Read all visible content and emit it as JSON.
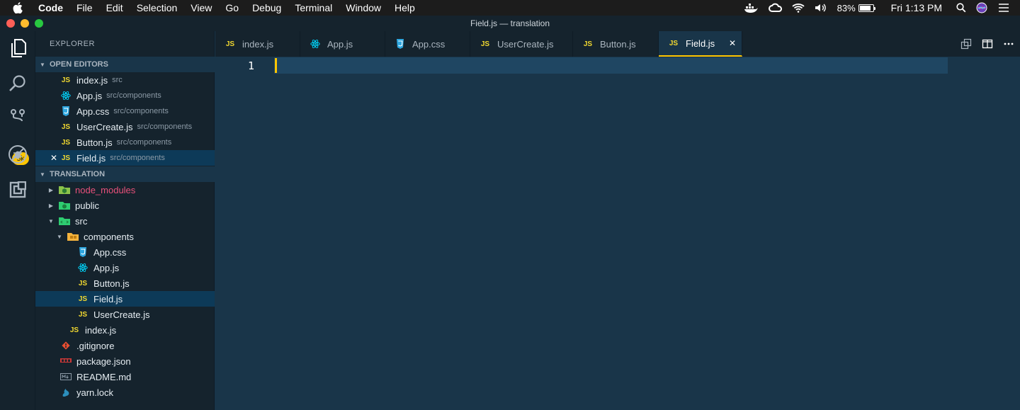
{
  "menubar": {
    "app": "Code",
    "items": [
      "File",
      "Edit",
      "Selection",
      "View",
      "Go",
      "Debug",
      "Terminal",
      "Window",
      "Help"
    ],
    "battery_percent": "83%",
    "battery_level": 0.83,
    "clock": "Fri 1:13 PM"
  },
  "window": {
    "title": "Field.js — translation"
  },
  "activity": {
    "scm_badge": "5k"
  },
  "sidebar": {
    "title": "EXPLORER",
    "open_editors_label": "OPEN EDITORS",
    "open_editors": [
      {
        "name": "index.js",
        "path": "src",
        "type": "js"
      },
      {
        "name": "App.js",
        "path": "src/components",
        "type": "react"
      },
      {
        "name": "App.css",
        "path": "src/components",
        "type": "css"
      },
      {
        "name": "UserCreate.js",
        "path": "src/components",
        "type": "js"
      },
      {
        "name": "Button.js",
        "path": "src/components",
        "type": "js"
      },
      {
        "name": "Field.js",
        "path": "src/components",
        "type": "js"
      }
    ],
    "project_label": "TRANSLATION",
    "tree": [
      {
        "name": "node_modules",
        "type": "folder-node"
      },
      {
        "name": "public",
        "type": "folder-public"
      },
      {
        "name": "src",
        "type": "folder-src"
      },
      {
        "name": "components",
        "type": "folder-components"
      },
      {
        "name": "App.css",
        "type": "css"
      },
      {
        "name": "App.js",
        "type": "react"
      },
      {
        "name": "Button.js",
        "type": "js"
      },
      {
        "name": "Field.js",
        "type": "js"
      },
      {
        "name": "UserCreate.js",
        "type": "js"
      },
      {
        "name": "index.js",
        "type": "js"
      },
      {
        "name": ".gitignore",
        "type": "git"
      },
      {
        "name": "package.json",
        "type": "npm"
      },
      {
        "name": "README.md",
        "type": "md"
      },
      {
        "name": "yarn.lock",
        "type": "yarn"
      }
    ]
  },
  "tabs": [
    {
      "label": "index.js",
      "type": "js"
    },
    {
      "label": "App.js",
      "type": "react"
    },
    {
      "label": "App.css",
      "type": "css"
    },
    {
      "label": "UserCreate.js",
      "type": "js"
    },
    {
      "label": "Button.js",
      "type": "js"
    },
    {
      "label": "Field.js",
      "type": "js"
    }
  ],
  "editor": {
    "line_number": "1"
  },
  "colors": {
    "accent": "#ffc600",
    "editor_bg": "#193549",
    "sidebar_bg": "#15232d",
    "node_modules": "#e8507a"
  }
}
